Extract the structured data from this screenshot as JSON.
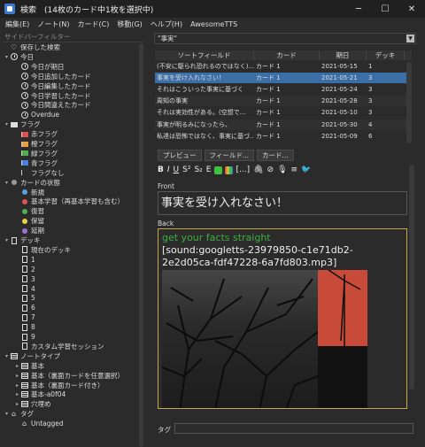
{
  "window": {
    "title": "検索　(14枚のカード中1枚を選択中)",
    "controls": [
      "minimize-icon",
      "maximize-icon",
      "close-icon"
    ]
  },
  "menu": [
    "編集(E)",
    "ノート(N)",
    "カード(C)",
    "移動(G)",
    "ヘルプ(H)",
    "AwesomeTTS"
  ],
  "sidebar": {
    "filter_placeholder": "サイドバーフィルター",
    "items": [
      {
        "label": "保存した検索",
        "icon": "heart-icon",
        "level": 0,
        "arrow": ""
      },
      {
        "label": "今日",
        "icon": "clock-icon",
        "level": 0,
        "arrow": "▾"
      },
      {
        "label": "今日が期日",
        "icon": "clock-icon",
        "level": 1,
        "arrow": ""
      },
      {
        "label": "今日追加したカード",
        "icon": "clock-icon",
        "level": 1,
        "arrow": ""
      },
      {
        "label": "今日編集したカード",
        "icon": "clock-icon",
        "level": 1,
        "arrow": ""
      },
      {
        "label": "今日学習したカード",
        "icon": "clock-icon",
        "level": 1,
        "arrow": ""
      },
      {
        "label": "今日間違えたカード",
        "icon": "clock-icon",
        "level": 1,
        "arrow": ""
      },
      {
        "label": "Overdue",
        "icon": "clock-icon",
        "level": 1,
        "arrow": ""
      },
      {
        "label": "フラグ",
        "icon": "flag-icon",
        "level": 0,
        "arrow": "▾"
      },
      {
        "label": "赤フラグ",
        "icon": "flag-icon",
        "level": 1,
        "arrow": "",
        "color": "#e05050"
      },
      {
        "label": "橙フラグ",
        "icon": "flag-icon",
        "level": 1,
        "arrow": "",
        "color": "#e8a040"
      },
      {
        "label": "緑フラグ",
        "icon": "flag-icon",
        "level": 1,
        "arrow": "",
        "color": "#50b050"
      },
      {
        "label": "青フラグ",
        "icon": "flag-icon",
        "level": 1,
        "arrow": "",
        "color": "#4a80e0"
      },
      {
        "label": "フラグなし",
        "icon": "flag-icon",
        "level": 1,
        "arrow": "",
        "color": "#2b2b2b"
      },
      {
        "label": "カードの状態",
        "icon": "circle-icon",
        "level": 0,
        "arrow": "▾",
        "color": "#999999"
      },
      {
        "label": "新規",
        "icon": "circle-icon",
        "level": 1,
        "arrow": "",
        "color": "#5aa0e0"
      },
      {
        "label": "基本学習（再基本学習も含む）",
        "icon": "circle-icon",
        "level": 1,
        "arrow": "",
        "color": "#e05050"
      },
      {
        "label": "復習",
        "icon": "circle-icon",
        "level": 1,
        "arrow": "",
        "color": "#50b050"
      },
      {
        "label": "保留",
        "icon": "circle-icon",
        "level": 1,
        "arrow": "",
        "color": "#e8d040"
      },
      {
        "label": "延期",
        "icon": "circle-icon",
        "level": 1,
        "arrow": "",
        "color": "#a070d0"
      },
      {
        "label": "デッキ",
        "icon": "card-icon",
        "level": 0,
        "arrow": "▾"
      },
      {
        "label": "現在のデッキ",
        "icon": "card-icon",
        "level": 1,
        "arrow": ""
      },
      {
        "label": "1",
        "icon": "card-icon",
        "level": 1,
        "arrow": ""
      },
      {
        "label": "2",
        "icon": "card-icon",
        "level": 1,
        "arrow": ""
      },
      {
        "label": "3",
        "icon": "card-icon",
        "level": 1,
        "arrow": ""
      },
      {
        "label": "4",
        "icon": "card-icon",
        "level": 1,
        "arrow": ""
      },
      {
        "label": "5",
        "icon": "card-icon",
        "level": 1,
        "arrow": ""
      },
      {
        "label": "6",
        "icon": "card-icon",
        "level": 1,
        "arrow": ""
      },
      {
        "label": "7",
        "icon": "card-icon",
        "level": 1,
        "arrow": ""
      },
      {
        "label": "8",
        "icon": "card-icon",
        "level": 1,
        "arrow": ""
      },
      {
        "label": "9",
        "icon": "card-icon",
        "level": 1,
        "arrow": ""
      },
      {
        "label": "カスタム学習セッション",
        "icon": "card-icon",
        "level": 1,
        "arrow": ""
      },
      {
        "label": "ノートタイプ",
        "icon": "note-icon",
        "level": 0,
        "arrow": "▾"
      },
      {
        "label": "基本",
        "icon": "note-icon",
        "level": 1,
        "arrow": "▸"
      },
      {
        "label": "基本（裏面カードを任意選択）",
        "icon": "note-icon",
        "level": 1,
        "arrow": "▸"
      },
      {
        "label": "基本（裏面カード付き）",
        "icon": "note-icon",
        "level": 1,
        "arrow": "▸"
      },
      {
        "label": "基本-a0f04",
        "icon": "note-icon",
        "level": 1,
        "arrow": "▸"
      },
      {
        "label": "穴埋め",
        "icon": "note-icon",
        "level": 1,
        "arrow": "▸"
      },
      {
        "label": "タグ",
        "icon": "tag-icon",
        "level": 0,
        "arrow": "▾"
      },
      {
        "label": "Untagged",
        "icon": "tag-icon",
        "level": 1,
        "arrow": ""
      }
    ]
  },
  "search": {
    "value": "\"事実\""
  },
  "table": {
    "headers": [
      "ソートフィールド",
      "カード",
      "期日",
      "デッキ"
    ],
    "rows": [
      [
        "(不安に駆られ恐れるのではなく)...",
        "カード 1",
        "2021-05-15",
        "1"
      ],
      [
        "事実を受け入れなさい！",
        "カード 1",
        "2021-05-21",
        "3"
      ],
      [
        "それはこういった事実に基づく",
        "カード 1",
        "2021-05-24",
        "3"
      ],
      [
        "周知の事実",
        "カード 1",
        "2021-05-28",
        "3"
      ],
      [
        "それは実効性がある。(空想で...",
        "カード 1",
        "2021-05-10",
        "3"
      ],
      [
        "事実が明るみになったら、",
        "カード 1",
        "2021-05-30",
        "4"
      ],
      [
        "私達は恐怖ではなく、事実に基づ...",
        "カード 1",
        "2021-05-09",
        "6"
      ]
    ],
    "selected_row": 1
  },
  "editor": {
    "buttons": [
      "プレビュー",
      "フィールド...",
      "カード..."
    ],
    "front_label": "Front",
    "front_value": "事実を受け入れなさい！",
    "back_label": "Back",
    "back_green": "get your facts straight",
    "back_sound": "[sound:googletts-23979850-c1e71db2-2e2d05ca-fdf47228-6a7fd803.mp3]",
    "tag_label": "タグ"
  },
  "colors": {
    "selection": "#3a6ea5",
    "accent_green": "#3fae3f",
    "back_border": "#c8a848"
  }
}
